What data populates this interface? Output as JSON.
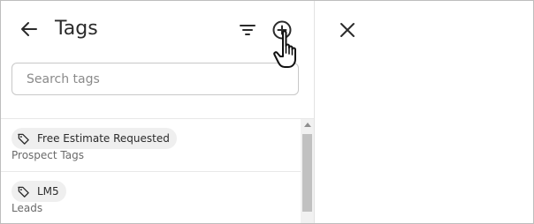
{
  "header": {
    "title": "Tags",
    "back_icon": "arrow-left-icon",
    "filter_icon": "filter-icon",
    "add_icon": "plus-circle-icon"
  },
  "search": {
    "placeholder": "Search tags",
    "value": ""
  },
  "tags": [
    {
      "name": "Free Estimate Requested",
      "category": "Prospect Tags",
      "icon": "tag-icon"
    },
    {
      "name": "LM5",
      "category": "Leads",
      "icon": "tag-icon"
    }
  ],
  "right_panel": {
    "close_icon": "close-icon"
  },
  "cursor": {
    "icon": "hand-pointer-icon"
  },
  "colors": {
    "text": "#2b2b2b",
    "muted": "#6a6a6a",
    "chip_bg": "#efefef",
    "border": "#c8c8c8",
    "divider": "#e8e8e8",
    "scroll_thumb": "#c1c1c1"
  }
}
